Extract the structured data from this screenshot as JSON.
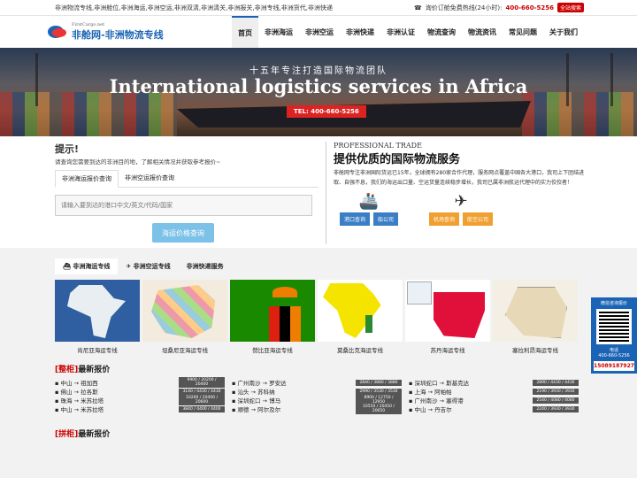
{
  "topbar": {
    "left_text": "非洲物流专线,非洲舱位,非洲海运,非洲空运,非洲双清,非洲清关,非洲报关,非洲专线,非洲货代,非洲快递",
    "hotline_label": "询价订舱免费热线(24小时):",
    "hotline_number": "400-660-5256",
    "search_button": "全站搜索"
  },
  "logo": {
    "small": "FirstCargo.net",
    "main": "非舱网-非洲物流专线"
  },
  "nav": [
    {
      "label": "首页",
      "active": true
    },
    {
      "label": "非洲海运"
    },
    {
      "label": "非洲空运"
    },
    {
      "label": "非洲快递"
    },
    {
      "label": "非洲认证"
    },
    {
      "label": "物流查询"
    },
    {
      "label": "物流资讯"
    },
    {
      "label": "常见问题"
    },
    {
      "label": "关于我们"
    }
  ],
  "banner": {
    "subtitle": "十五年专注打造国际物流团队",
    "title": "International logistics services in Africa",
    "tel": "TEL: 400-660-5256"
  },
  "quote": {
    "title": "提示!",
    "desc": "请查询您需要到达的非洲目的地，了解相关情况并获取参考报价~",
    "tabs": [
      "非洲海运报价查询",
      "非洲空运报价查询"
    ],
    "placeholder": "请输入要到达的港口中文/英文/代码/国家",
    "button": "海运价格查询"
  },
  "pro": {
    "en": "PROFESSIONAL TRADE",
    "title": "提供优质的国际物流服务",
    "text": "非舱网专注非洲国际货运已15年。全球拥有280家合作代理，服务网点覆盖中国各大港口，我司上下团结进取、自强不息，我们的海运出口量、空运货量连续稳步增长，我司已属非洲航运代理中的实力佼佼者！",
    "sea_buttons": [
      "港口查询",
      "船公司"
    ],
    "air_buttons": [
      "机场查询",
      "航空公司"
    ]
  },
  "lower_tabs": [
    "非洲海运专线",
    "非洲空运专线",
    "非洲快递服务"
  ],
  "routes": [
    {
      "label": "肯尼亚海运专线"
    },
    {
      "label": "坦桑尼亚海运专线"
    },
    {
      "label": "赞比亚海运专线"
    },
    {
      "label": "莫桑比克海运专线"
    },
    {
      "label": "苏丹海运专线"
    },
    {
      "label": "塞拉利昂海运专线"
    }
  ],
  "prices": {
    "tag": "[整柜]",
    "title": "最新报价",
    "tag2": "[拼柜]",
    "title2": "最新报价",
    "columns": [
      [
        {
          "route": "中山 → 祖加西",
          "val": "9900 / 20200 / 20400"
        },
        {
          "route": "佛山 → 拉各斯",
          "val": "3140 / 4430 / 4430"
        },
        {
          "route": "珠海 → 米苏拉塔",
          "val": "10200 / 20400 / 20600"
        },
        {
          "route": "中山 → 米苏拉塔",
          "val": "3840 / 4400 / 4400"
        }
      ],
      [
        {
          "route": "广州南沙 → 罗安达",
          "val": "2840 / 3880 / 3880"
        },
        {
          "route": "汕头 → 苏科纳",
          "val": "2990 / 3530 / 3530"
        },
        {
          "route": "深圳蛇口 → 博马",
          "val": "8900 / 12750 / 12950"
        },
        {
          "route": "顺德 → 阿尔及尔",
          "val": "10550 / 20450 / 20650"
        }
      ],
      [
        {
          "route": "深圳蛇口 → 斯基克达",
          "val": "2890 / 4430 / 4430"
        },
        {
          "route": "上海 → 阿帕帕",
          "val": "2190 / 3930 / 3930"
        },
        {
          "route": "广州南沙 → 塞得港",
          "val": "2540 / 4080 / 4080"
        },
        {
          "route": "中山 → 丹吉尔",
          "val": "2240 / 3930 / 3930"
        }
      ]
    ]
  },
  "side": {
    "wechat": "微信咨询报价",
    "tel_label": "电话",
    "tel": "400-660-5256",
    "hot": "15089187927"
  }
}
